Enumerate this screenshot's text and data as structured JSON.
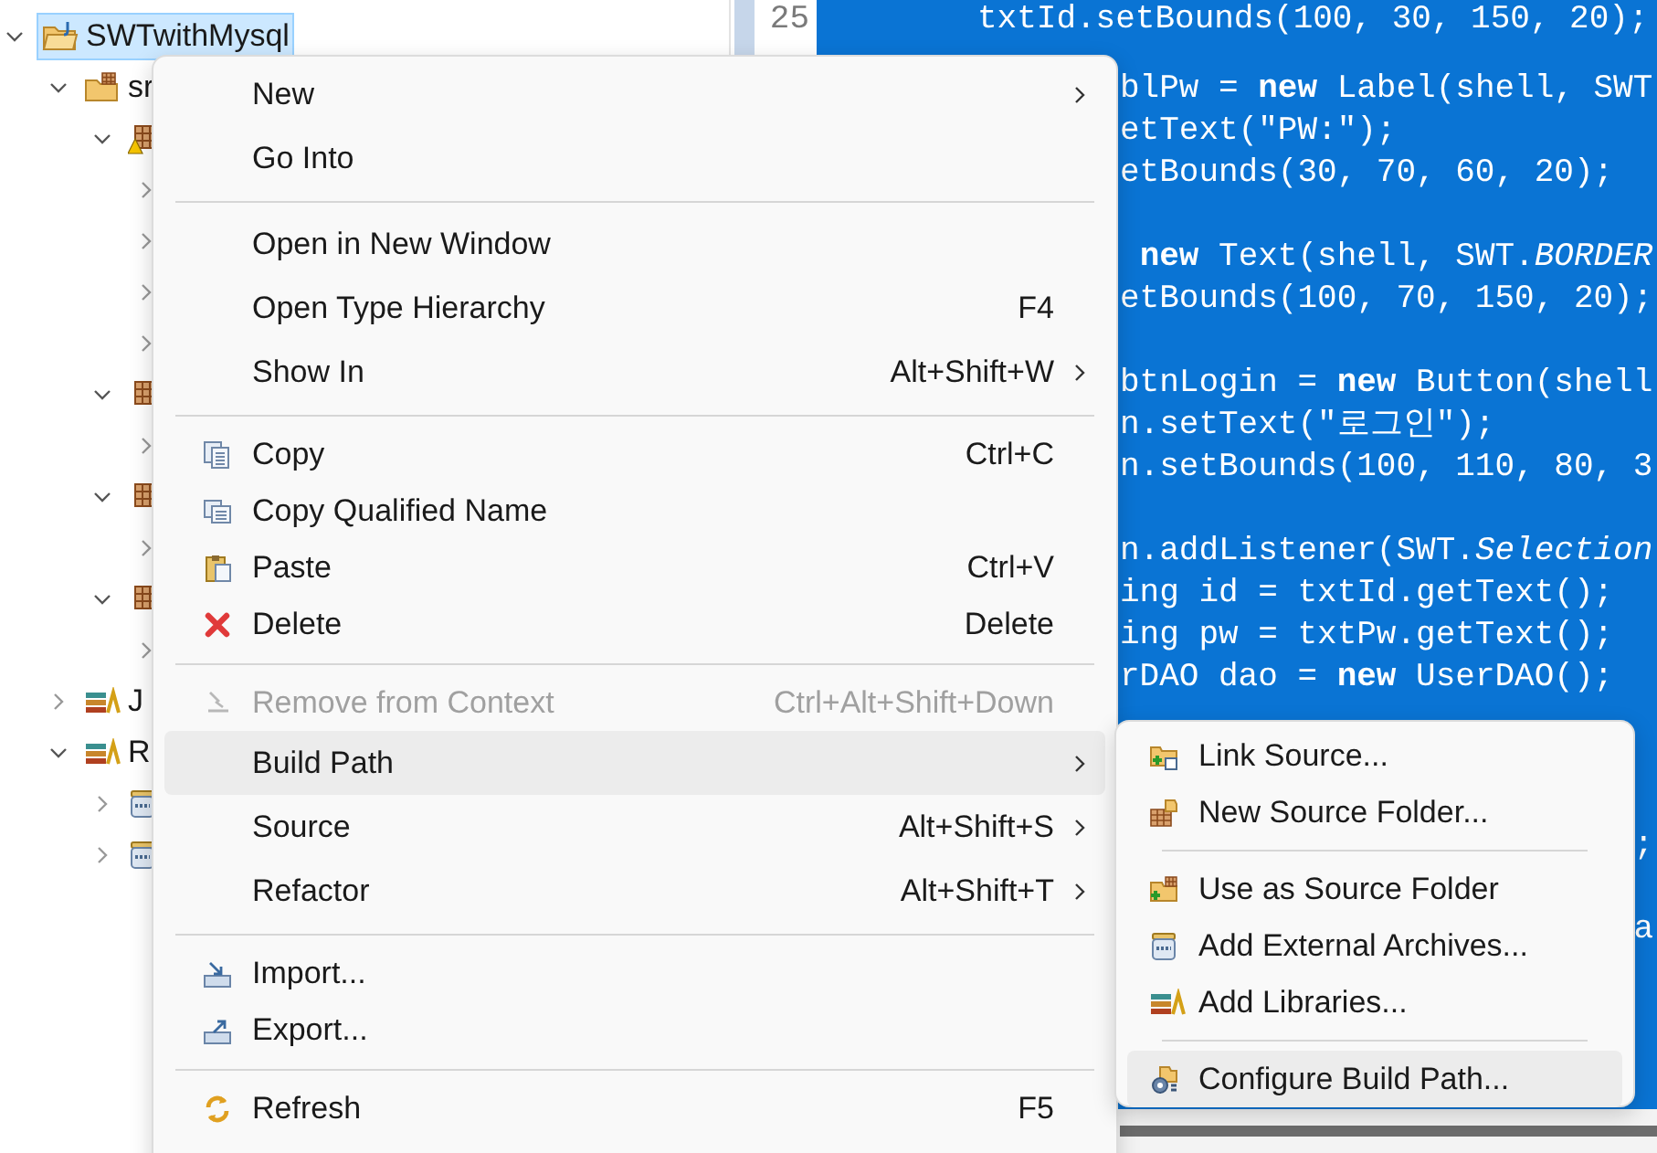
{
  "tree": [
    {
      "label": "SWTwithMysql",
      "kind": "project",
      "expanded": true,
      "selected": true,
      "children": [
        {
          "label": "sr",
          "kind": "source-folder",
          "expanded": true,
          "selected": false,
          "children": [
            {
              "kind": "package-warning",
              "expanded": true,
              "selected": false,
              "children": [
                {
                  "expanded": false,
                  "selected": false
                },
                {
                  "expanded": false,
                  "selected": false
                },
                {
                  "expanded": false,
                  "selected": false
                },
                {
                  "expanded": false,
                  "selected": false
                }
              ]
            },
            {
              "kind": "package",
              "expanded": true,
              "selected": false,
              "children": [
                {
                  "expanded": false,
                  "selected": false
                }
              ]
            },
            {
              "kind": "package",
              "expanded": true,
              "selected": false,
              "children": [
                {
                  "expanded": false,
                  "selected": false
                }
              ]
            },
            {
              "kind": "package",
              "expanded": true,
              "selected": false,
              "children": [
                {
                  "expanded": false,
                  "selected": false
                }
              ]
            }
          ]
        },
        {
          "label": "J",
          "kind": "library",
          "expanded": false,
          "selected": false
        },
        {
          "label": "R",
          "kind": "library",
          "expanded": true,
          "selected": false,
          "children": [
            {
              "kind": "jar",
              "expanded": false,
              "selected": false
            },
            {
              "kind": "jar",
              "expanded": false,
              "selected": false
            }
          ]
        }
      ]
    }
  ],
  "gutter": {
    "line_number": "25"
  },
  "editor": {
    "first_line": "txtId.setBounds(100, 30, 150, 20);",
    "lines": [
      {
        "kind": "code",
        "text": "blPw = **new** Label(shell, SWT"
      },
      {
        "kind": "code",
        "text": "etText(\"PW:\");"
      },
      {
        "kind": "code",
        "text": "etBounds(30, 70, 60, 20);"
      },
      {
        "kind": "blank"
      },
      {
        "kind": "code",
        "text": " **new** Text(shell, SWT.*BORDER*"
      },
      {
        "kind": "code",
        "text": "etBounds(100, 70, 150, 20);"
      },
      {
        "kind": "blank"
      },
      {
        "kind": "code",
        "text": "btnLogin = **new** Button(shell"
      },
      {
        "kind": "code",
        "text": "n.setText(\"로그인\");"
      },
      {
        "kind": "code",
        "text": "n.setBounds(100, 110, 80, 3"
      },
      {
        "kind": "blank"
      },
      {
        "kind": "code",
        "text": "n.addListener(SWT.*Selection*"
      },
      {
        "kind": "code",
        "text": "ing id = txtId.getText();"
      },
      {
        "kind": "code",
        "text": "ing pw = txtPw.getText();"
      },
      {
        "kind": "code",
        "text": "rDAO dao = **new** UserDAO();"
      },
      {
        "kind": "blank"
      },
      {
        "kind": "blank"
      },
      {
        "kind": "blank"
      },
      {
        "kind": "tail",
        "text": ";"
      },
      {
        "kind": "blank"
      },
      {
        "kind": "tail",
        "text": "a"
      }
    ]
  },
  "context_menu": {
    "groups": [
      {
        "items": [
          {
            "label": "New",
            "submenu": true,
            "selected": false,
            "disabled": false
          },
          {
            "label": "Go Into",
            "submenu": false,
            "selected": false,
            "disabled": false
          }
        ]
      },
      {
        "items": [
          {
            "label": "Open in New Window",
            "submenu": false,
            "selected": false,
            "disabled": false
          },
          {
            "label": "Open Type Hierarchy",
            "shortcut": "F4",
            "submenu": false,
            "selected": false,
            "disabled": false
          },
          {
            "label": "Show In",
            "shortcut": "Alt+Shift+W",
            "submenu": true,
            "selected": false,
            "disabled": false
          }
        ]
      },
      {
        "items": [
          {
            "label": "Copy",
            "kind": "copy",
            "shortcut": "Ctrl+C",
            "submenu": false,
            "selected": false,
            "disabled": false
          },
          {
            "label": "Copy Qualified Name",
            "kind": "copy-qualified",
            "submenu": false,
            "selected": false,
            "disabled": false
          },
          {
            "label": "Paste",
            "kind": "paste",
            "shortcut": "Ctrl+V",
            "submenu": false,
            "selected": false,
            "disabled": false
          },
          {
            "label": "Delete",
            "kind": "delete",
            "shortcut": "Delete",
            "submenu": false,
            "selected": false,
            "disabled": false
          }
        ]
      },
      {
        "items": [
          {
            "label": "Remove from Context",
            "kind": "remove",
            "shortcut": "Ctrl+Alt+Shift+Down",
            "submenu": false,
            "selected": false,
            "disabled": true
          },
          {
            "label": "Build Path",
            "submenu": true,
            "selected": true,
            "disabled": false
          },
          {
            "label": "Source",
            "shortcut": "Alt+Shift+S",
            "submenu": true,
            "selected": false,
            "disabled": false
          },
          {
            "label": "Refactor",
            "shortcut": "Alt+Shift+T",
            "submenu": true,
            "selected": false,
            "disabled": false
          }
        ]
      },
      {
        "items": [
          {
            "label": "Import...",
            "kind": "import",
            "submenu": false,
            "selected": false,
            "disabled": false
          },
          {
            "label": "Export...",
            "kind": "export",
            "submenu": false,
            "selected": false,
            "disabled": false
          }
        ]
      },
      {
        "items": [
          {
            "label": "Refresh",
            "kind": "refresh",
            "shortcut": "F5",
            "submenu": false,
            "selected": false,
            "disabled": false
          }
        ]
      }
    ]
  },
  "build_path_menu": {
    "groups": [
      {
        "items": [
          {
            "label": "Link Source...",
            "kind": "link-source",
            "selected": false
          },
          {
            "label": "New Source Folder...",
            "kind": "new-source-folder",
            "selected": false
          }
        ]
      },
      {
        "items": [
          {
            "label": "Use as Source Folder",
            "kind": "use-source-folder",
            "selected": false
          },
          {
            "label": "Add External Archives...",
            "kind": "jar",
            "selected": false
          },
          {
            "label": "Add Libraries...",
            "kind": "library",
            "selected": false
          }
        ]
      },
      {
        "items": [
          {
            "label": "Configure Build Path...",
            "kind": "configure",
            "selected": true
          }
        ]
      }
    ]
  }
}
